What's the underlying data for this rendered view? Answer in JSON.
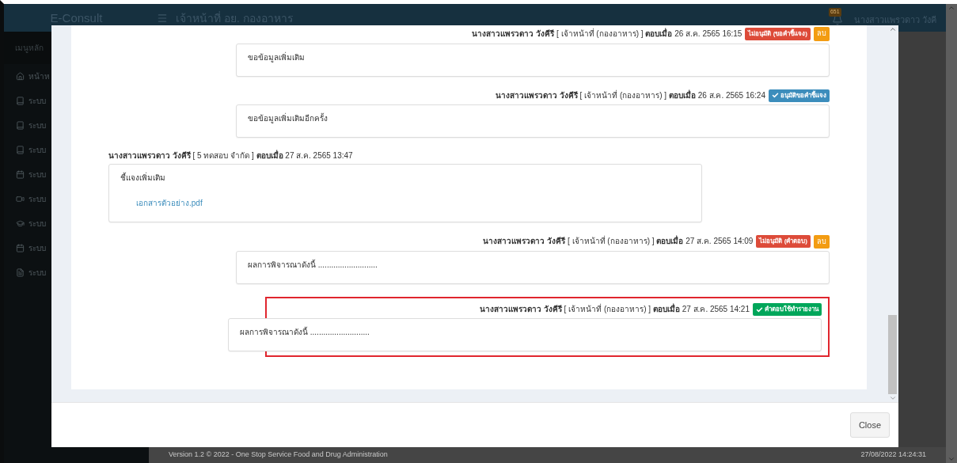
{
  "app": {
    "brand": "E-Consult",
    "header_title": "เจ้าหน้าที่ อย. กองอาหาร",
    "notification_count": "651",
    "user_name": "นางสาวแพรวดาว วังคี"
  },
  "sidebar": {
    "heading": "เมนูหลัก",
    "items": [
      "หน้าห",
      "ระบบ",
      "ระบบ",
      "ระบบ",
      "ระบบ",
      "ระบบ",
      "ระบบ",
      "ระบบ",
      "ระบบ"
    ]
  },
  "footer": {
    "version": "Version 1.2 © 2022 - One Stop Service Food and Drug Administration",
    "datetime": "27/08/2022 14:24:31"
  },
  "modal": {
    "messages": [
      {
        "kind": "staff",
        "author": "นางสาวแพรวดาว วังคีรี",
        "role": "[ เจ้าหน้าที่ (กองอาหาร) ]",
        "replied_label": "ตอบเมื่อ",
        "datetime": "26 ส.ค. 2565 16:15",
        "status": {
          "text": "ไม่อนุมัติ (ขอคำชี้แจง)",
          "kind": "danger"
        },
        "delete": "ลบ",
        "body": "ขอข้อมูลเพิ่มเติม",
        "highlighted": false
      },
      {
        "kind": "staff",
        "author": "นางสาวแพรวดาว วังคีรี",
        "role": "[ เจ้าหน้าที่ (กองอาหาร) ]",
        "replied_label": "ตอบเมื่อ",
        "datetime": "26 ส.ค. 2565 16:24",
        "status": {
          "text": "อนุมัติขอคำชี้แจง",
          "kind": "info"
        },
        "body": "ขอข้อมูลเพิ่มเติมอีกครั้ง",
        "highlighted": false
      },
      {
        "kind": "applicant",
        "author": "นางสาวแพรวดาว วังคีรี",
        "role": "[ 5 ทดสอบ จำกัด ]",
        "replied_label": "ตอบเมื่อ",
        "datetime": "27 ส.ค. 2565 13:47",
        "body": "ชี้แจงเพิ่มเติม",
        "attachment": "เอกสารตัวอย่าง.pdf",
        "highlighted": false
      },
      {
        "kind": "staff",
        "author": "นางสาวแพรวดาว วังคีรี",
        "role": "[ เจ้าหน้าที่ (กองอาหาร) ]",
        "replied_label": "ตอบเมื่อ",
        "datetime": "27 ส.ค. 2565 14:09",
        "status": {
          "text": "ไม่อนุมัติ (คำตอบ)",
          "kind": "danger"
        },
        "delete": "ลบ",
        "body": "ผลการพิจารณาดังนี้ ...........................",
        "highlighted": false
      },
      {
        "kind": "staff",
        "author": "นางสาวแพรวดาว วังคีรี",
        "role": "[ เจ้าหน้าที่ (กองอาหาร) ]",
        "replied_label": "ตอบเมื่อ",
        "datetime": "27 ส.ค. 2565 14:21",
        "status": {
          "text": "คำตอบใช้ทำรายงาน",
          "kind": "success"
        },
        "body": "ผลการพิจารณาดังนี้ ...........................",
        "highlighted": true
      }
    ],
    "close_button": "Close"
  }
}
